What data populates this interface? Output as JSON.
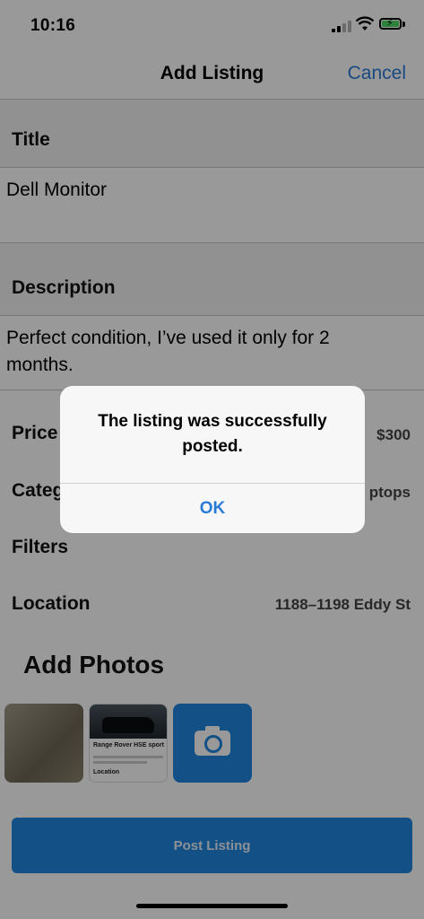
{
  "status_bar": {
    "time": "10:16"
  },
  "nav": {
    "title": "Add Listing",
    "cancel_label": "Cancel"
  },
  "form": {
    "title_label": "Title",
    "title_value": "Dell Monitor",
    "description_label": "Description",
    "description_value": "Perfect condition, I’ve used it only for 2 months.",
    "price_label": "Price",
    "price_value": "$300",
    "category_label": "Categ",
    "category_value": "ptops",
    "filters_label": "Filters",
    "location_label": "Location",
    "location_value": "1188–1198 Eddy St"
  },
  "photos": {
    "heading": "Add Photos",
    "items": [
      {
        "icon": "photo-thumbnail"
      },
      {
        "title": "Range Rover HSE sport",
        "location_label": "Location"
      },
      {
        "icon": "camera-icon"
      }
    ]
  },
  "post_button_label": "Post Listing",
  "alert": {
    "message": "The listing was successfully posted.",
    "ok_label": "OK"
  },
  "colors": {
    "accent": "#1f86e0",
    "link": "#2a7bd6"
  }
}
